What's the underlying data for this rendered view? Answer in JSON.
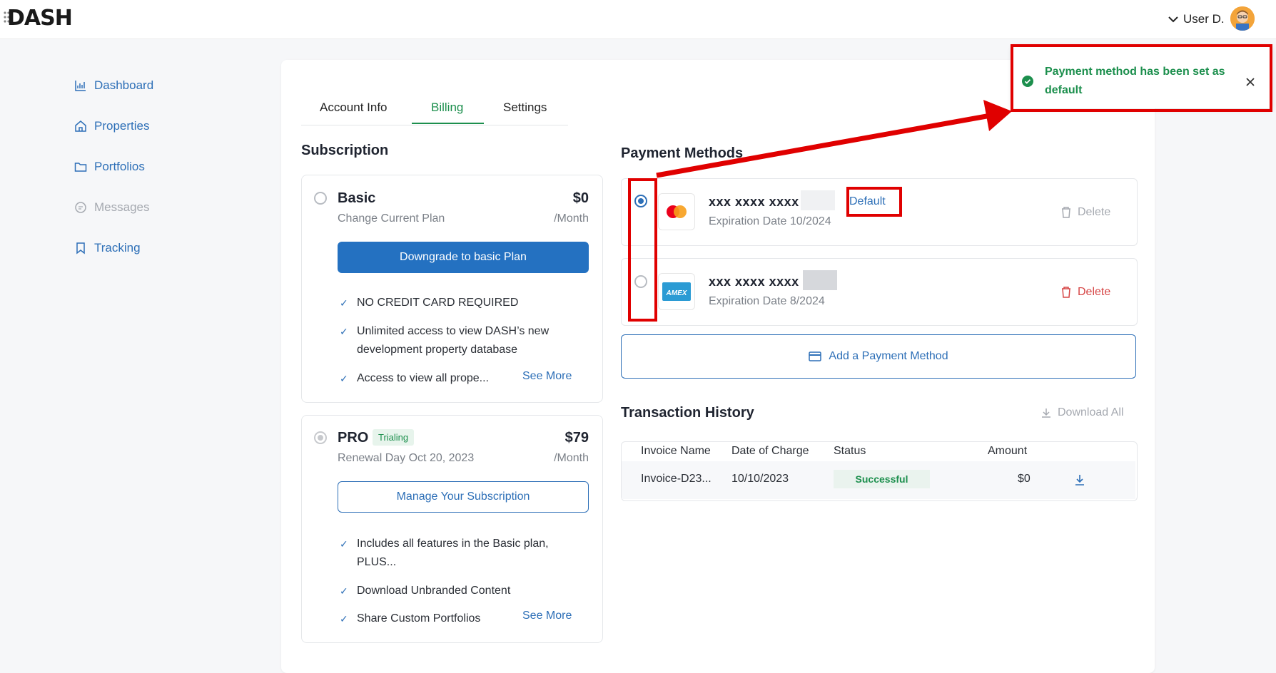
{
  "brand": {
    "logo": "DASH"
  },
  "user": {
    "name": "User D."
  },
  "sidebar": {
    "items": [
      {
        "label": "Dashboard",
        "icon": "chart-icon",
        "enabled": true
      },
      {
        "label": "Properties",
        "icon": "home-icon",
        "enabled": true
      },
      {
        "label": "Portfolios",
        "icon": "folder-icon",
        "enabled": true
      },
      {
        "label": "Messages",
        "icon": "message-icon",
        "enabled": false
      },
      {
        "label": "Tracking",
        "icon": "bookmark-icon",
        "enabled": true
      }
    ]
  },
  "tabs": [
    {
      "label": "Account Info",
      "active": false
    },
    {
      "label": "Billing",
      "active": true
    },
    {
      "label": "Settings",
      "active": false
    }
  ],
  "subscription": {
    "title": "Subscription",
    "basic": {
      "name": "Basic",
      "price": "$0",
      "period": "/Month",
      "subtitle": "Change Current Plan",
      "button": "Downgrade to basic Plan",
      "features": [
        "NO CREDIT CARD REQUIRED",
        "Unlimited access to view DASH’s new development property database",
        "Access to view all prope..."
      ],
      "see_more": "See More"
    },
    "pro": {
      "name": "PRO",
      "badge": "Trialing",
      "price": "$79",
      "period": "/Month",
      "subtitle": "Renewal Day Oct 20, 2023",
      "button": "Manage Your Subscription",
      "features": [
        "Includes all features in the Basic plan, PLUS...",
        "Download Unbranded Content",
        "Share Custom Portfolios"
      ],
      "see_more": "See More"
    }
  },
  "payment_methods": {
    "title": "Payment Methods",
    "cards": [
      {
        "number": "xxx xxxx xxxx",
        "default_label": "Default",
        "expiration": "Expiration Date 10/2024",
        "delete": "Delete",
        "selected": true,
        "brand_icon": "mastercard-icon"
      },
      {
        "number": "xxx xxxx xxxx",
        "expiration": "Expiration Date 8/2024",
        "delete": "Delete",
        "selected": false,
        "brand_icon": "amex-icon",
        "brand_text": "AMEX"
      }
    ],
    "add_button": "Add a Payment Method"
  },
  "transactions": {
    "title": "Transaction History",
    "download_all": "Download All",
    "columns": [
      "Invoice Name",
      "Date of Charge",
      "Status",
      "Amount"
    ],
    "rows": [
      {
        "invoice": "Invoice-D23...",
        "date": "10/10/2023",
        "status": "Successful",
        "amount": "$0"
      }
    ]
  },
  "toast": {
    "message": "Payment method has been set as default"
  },
  "colors": {
    "accent": "#2d6fb7",
    "success": "#1c8f4d",
    "danger": "#d64545",
    "annotation": "#e00000"
  }
}
